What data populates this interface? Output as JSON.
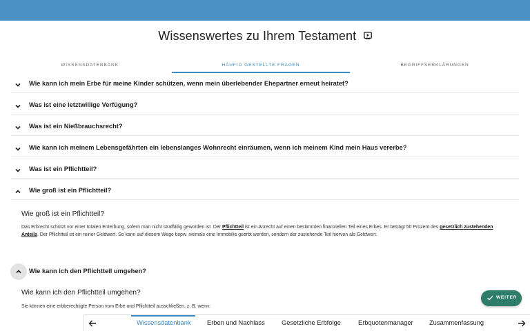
{
  "page": {
    "title": "Wissenswertes zu Ihrem Testament",
    "title_icon": "play-box-icon"
  },
  "tabs": [
    {
      "label": "Wissensdatenbank",
      "active": false
    },
    {
      "label": "Häufig gestellte Fragen",
      "active": true
    },
    {
      "label": "Begriffserklärungen",
      "active": false
    }
  ],
  "faq": [
    {
      "question": "Wie kann ich mein Erbe für meine Kinder schützen, wenn mein überlebender Ehepartner erneut heiratet?",
      "expanded": false
    },
    {
      "question": "Was ist eine letztwillige Verfügung?",
      "expanded": false
    },
    {
      "question": "Was ist ein Nießbrauchsrecht?",
      "expanded": false
    },
    {
      "question": "Wie kann ich meinem Lebensgefährten ein lebenslanges Wohnrecht einräumen, wenn ich meinem Kind mein Haus vererbe?",
      "expanded": false
    },
    {
      "question": "Was ist ein Pflichtteil?",
      "expanded": false
    },
    {
      "question": "Wie groß ist ein Pflichtteil?",
      "expanded": true
    },
    {
      "question": "Wie kann ich den Pflichtteil umgehen?",
      "expanded": true
    }
  ],
  "answer_pflichtteil_groesse": {
    "title": "Wie groß ist ein Pflichtteil?",
    "text_1": "Das Erbrecht schützt vor einer totalen Enterbung, sofern man nicht straffällig geworden ist. Der ",
    "link_1": "Pflichtteil",
    "text_2": " ist ein Anrecht auf einen bestimmten finanziellen Teil eines Erbes. Er beträgt 50 Prozent des ",
    "link_2": "gesetzlich zustehenden Anteils",
    "text_3": ". Der Pflichtteil ist ein reiner Geldwert. So kann auf diesem Wege bspw. niemals eine Immobilie geerbt werden, sondern der zustehende Teil hiervon als Geldwert."
  },
  "answer_pflichtteil_umgehen": {
    "title": "Wie kann ich den Pflichtteil umgehen?",
    "text": "Sie können eine erbberechtigte Person vom Erbe und Pflichtteil ausschließen, z. B. wenn:"
  },
  "fab": {
    "label": "WEITER",
    "icon": "check-icon",
    "color": "#2e7d6a"
  },
  "bottom_nav": {
    "items": [
      {
        "label": "Wissensdatenbank",
        "active": true
      },
      {
        "label": "Erben und Nachlass",
        "active": false
      },
      {
        "label": "Gesetzliche Erbfolge",
        "active": false
      },
      {
        "label": "Erbquotenmanager",
        "active": false
      },
      {
        "label": "Zusammenfassung",
        "active": false
      }
    ],
    "prev_icon": "arrow-left-icon",
    "next_icon": "arrow-right-icon"
  },
  "colors": {
    "header_bar": "#4a90c4",
    "accent": "#3a89c2"
  }
}
